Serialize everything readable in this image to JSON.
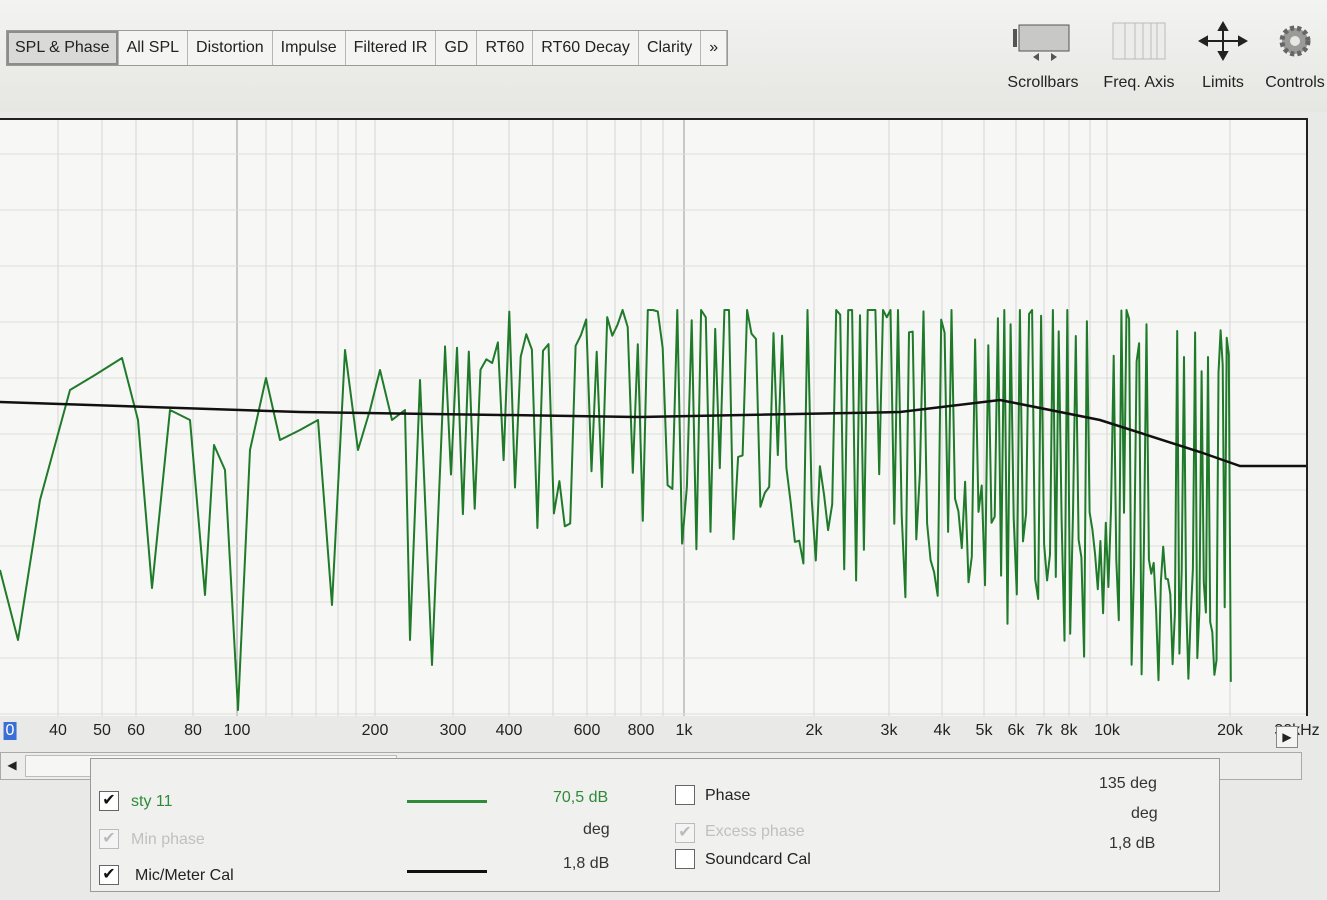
{
  "tabs": [
    "SPL & Phase",
    "All SPL",
    "Distortion",
    "Impulse",
    "Filtered IR",
    "GD",
    "RT60",
    "RT60 Decay",
    "Clarity",
    "»"
  ],
  "toolbar": {
    "scrollbars": "Scrollbars",
    "freq_axis": "Freq. Axis",
    "limits": "Limits",
    "controls": "Controls"
  },
  "freq_axis": {
    "first_tick": "0",
    "ticks": [
      "40",
      "50",
      "60",
      "80",
      "100",
      "200",
      "300",
      "400",
      "600",
      "800",
      "1k",
      "2k",
      "3k",
      "4k",
      "5k",
      "6k",
      "7k",
      "8k",
      "10k",
      "20k",
      "30kHz"
    ]
  },
  "legend": {
    "row1": {
      "name": "sty 11",
      "value": "70,5 dB",
      "phase_label": "Phase",
      "phase_value": "135 deg",
      "checked": true,
      "color": "#2e8b3a"
    },
    "row2": {
      "name": "Min phase",
      "unit": "deg",
      "excess_label": "Excess phase",
      "excess_unit": "deg"
    },
    "row3": {
      "name": "Mic/Meter Cal",
      "value": "1,8 dB",
      "soundcard_label": "Soundcard Cal",
      "soundcard_value": "1,8 dB",
      "checked": true,
      "color": "#111111"
    }
  },
  "colors": {
    "trace": "#1f7a2a",
    "cal_line": "#111111",
    "grid": "#d0d0cc"
  }
}
